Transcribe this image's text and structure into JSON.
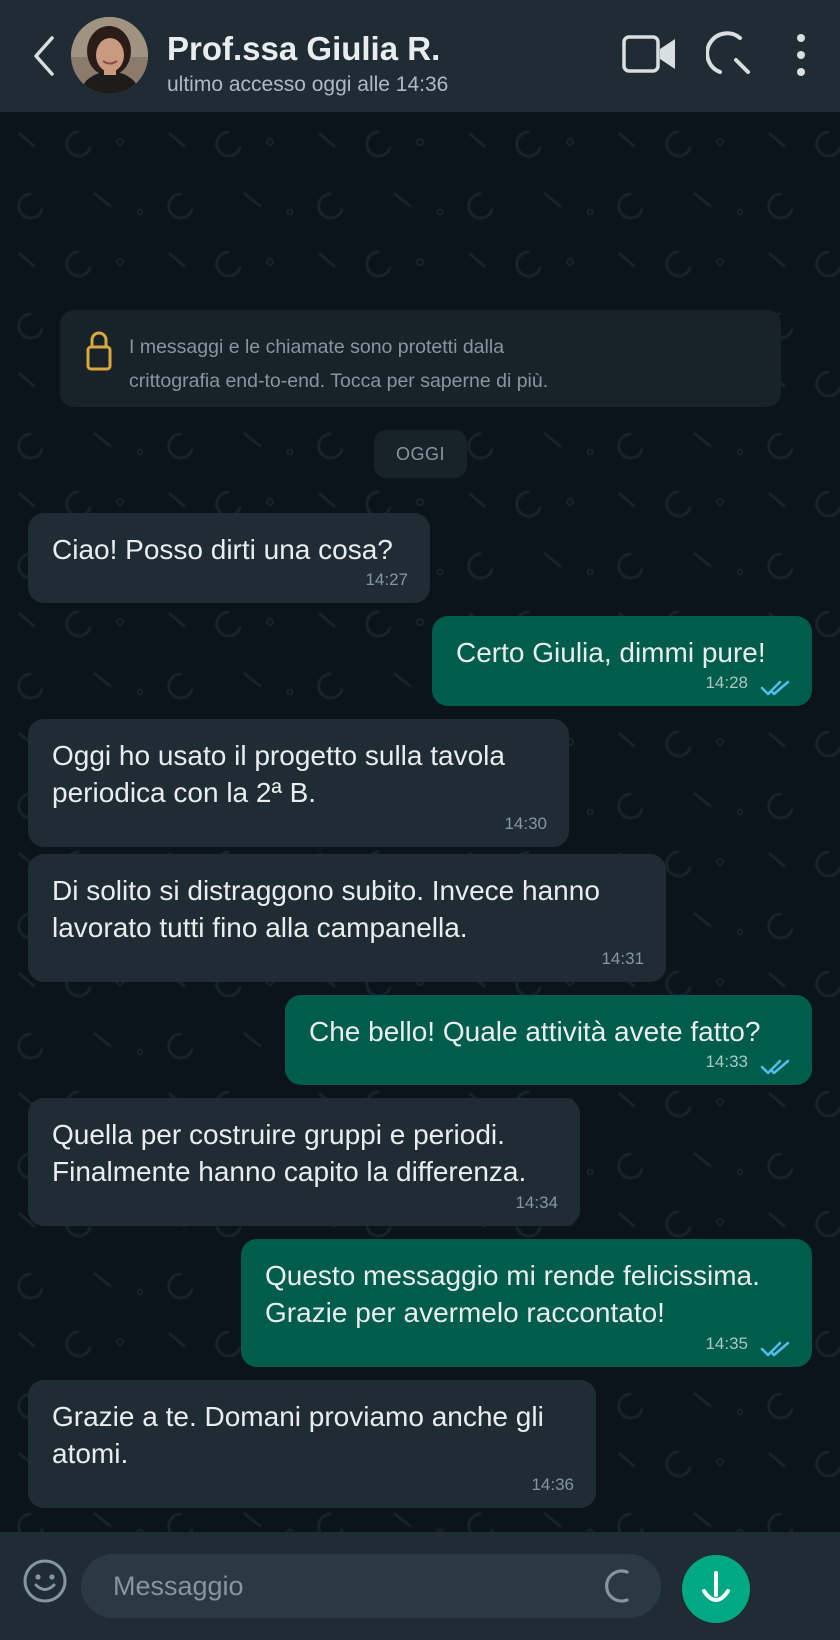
{
  "header": {
    "contact_name": "Prof.ssa Giulia R.",
    "last_seen": "ultimo accesso oggi alle 14:36",
    "back_icon": "chevron-left-icon",
    "video_icon": "video-camera-icon",
    "call_icon": "phone-call-icon",
    "menu_icon": "kebab-menu-icon"
  },
  "notice": {
    "line1": "I messaggi e le chiamate sono protetti dalla",
    "line2": "crittografia end-to-end. Tocca per saperne di più.",
    "icon": "lock-icon"
  },
  "date_divider": "OGGI",
  "messages": [
    {
      "direction": "in",
      "text": "Ciao! Posso dirti una cosa?",
      "time": "14:27"
    },
    {
      "direction": "out",
      "text": "Certo Giulia, dimmi pure!",
      "time": "14:28",
      "status": "read"
    },
    {
      "direction": "in",
      "text": "Oggi ho usato il progetto sulla tavola\nperiodica con la 2ª B.",
      "time": "14:30"
    },
    {
      "direction": "in",
      "text": "Di solito si distraggono subito. Invece hanno\nlavorato tutti fino alla campanella.",
      "time": "14:31"
    },
    {
      "direction": "out",
      "text": "Che bello! Quale attività avete fatto?",
      "time": "14:33",
      "status": "read"
    },
    {
      "direction": "in",
      "text": "Quella per costruire gruppi e periodi.\nFinalmente hanno capito la differenza.",
      "time": "14:34"
    },
    {
      "direction": "out",
      "text": "Questo messaggio mi rende felicissima.\nGrazie per avermelo raccontato!",
      "time": "14:35",
      "status": "read"
    },
    {
      "direction": "in",
      "text": "Grazie a te. Domani proviamo anche gli\natomi.",
      "time": "14:36"
    }
  ],
  "composer": {
    "placeholder": "Messaggio",
    "emoji_icon": "emoji-icon",
    "attach_icon": "attachment-icon",
    "mic_icon": "microphone-icon"
  },
  "colors": {
    "background": "#0b141a",
    "header": "#1f2c34",
    "incoming_bubble": "#202c33",
    "outgoing_bubble": "#005c4b",
    "accent": "#00a884",
    "read_ticks": "#53bdeb"
  }
}
